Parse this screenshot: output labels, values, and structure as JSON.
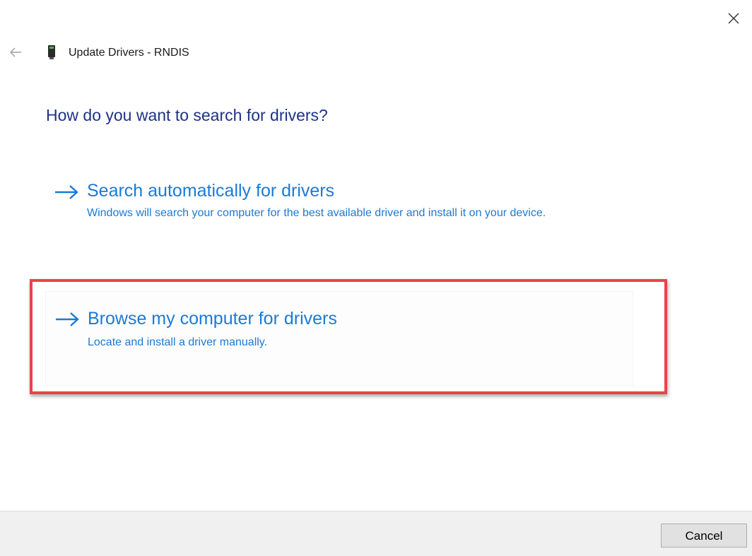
{
  "window": {
    "title": "Update Drivers - RNDIS",
    "close_icon": "close-icon",
    "back_icon": "back-arrow-icon",
    "device_icon": "usb-device-icon"
  },
  "main": {
    "heading": "How do you want to search for drivers?",
    "options": [
      {
        "icon": "right-arrow-icon",
        "title": "Search automatically for drivers",
        "description": "Windows will search your computer for the best available driver and install it on your device."
      },
      {
        "icon": "right-arrow-icon",
        "title": "Browse my computer for drivers",
        "description": "Locate and install a driver manually.",
        "highlighted": true
      }
    ]
  },
  "footer": {
    "cancel_label": "Cancel"
  },
  "colors": {
    "link_blue": "#1c7ad6",
    "heading_blue": "#1e3287",
    "highlight_red": "#e9434a",
    "footer_bg": "#f0f0f0"
  }
}
